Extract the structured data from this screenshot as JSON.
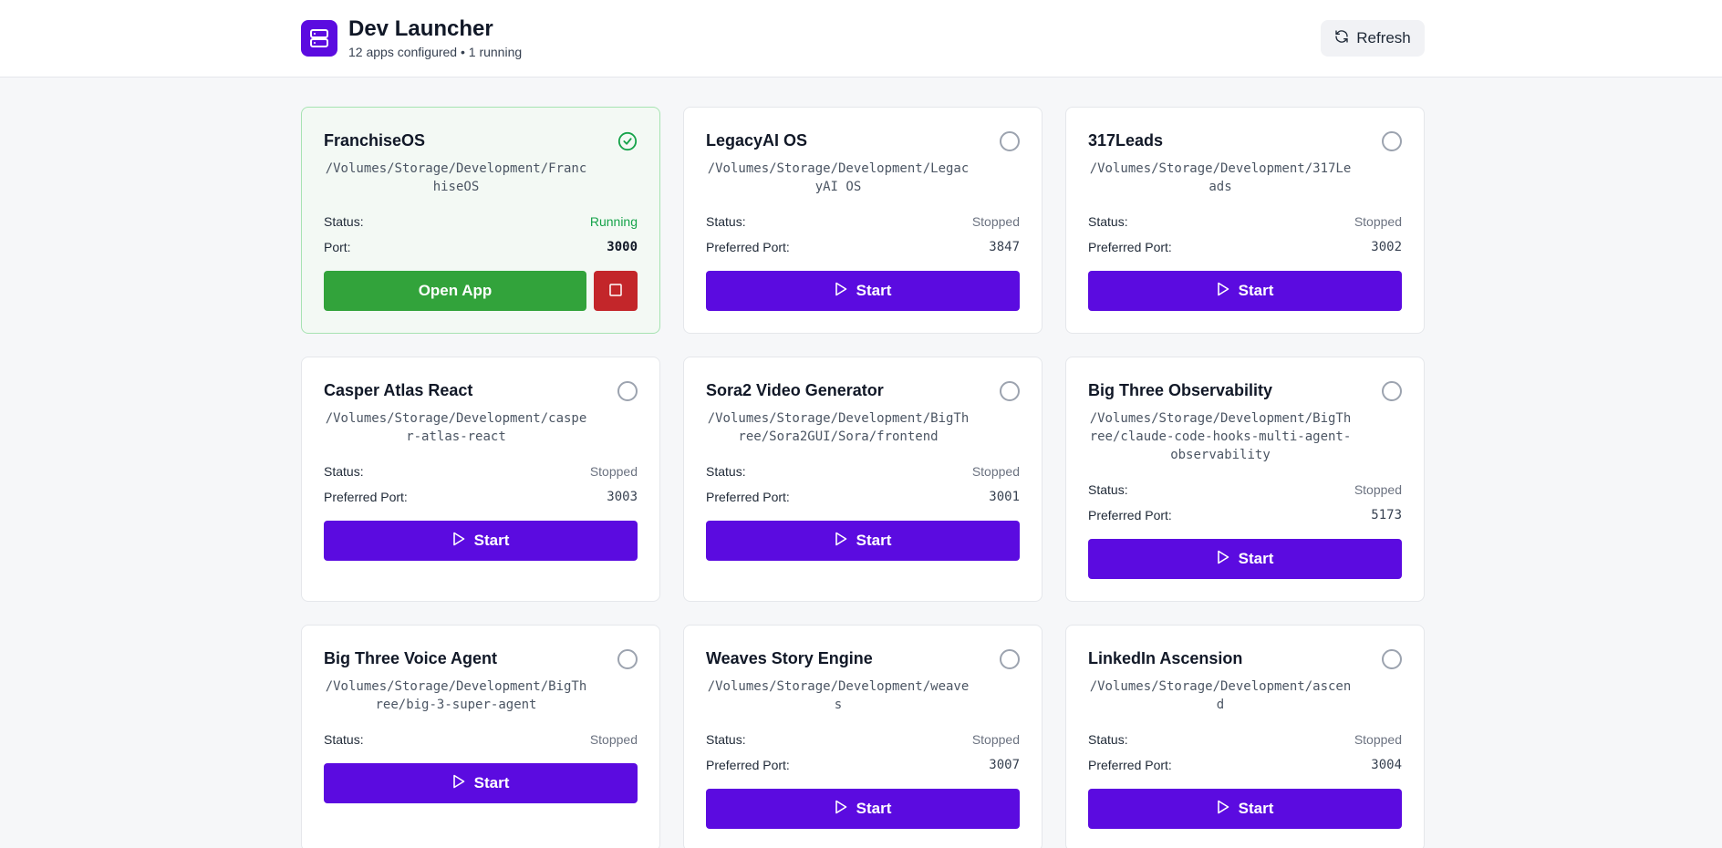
{
  "header": {
    "title": "Dev Launcher",
    "subtitle": "12 apps configured • 1 running",
    "refresh_label": "Refresh"
  },
  "labels": {
    "status": "Status:",
    "port": "Port:",
    "preferred_port": "Preferred Port:",
    "start": "Start",
    "open_app": "Open App"
  },
  "colors": {
    "accent": "#5b0be0",
    "running": "#16a34a",
    "stop": "#c3262a"
  },
  "apps": [
    {
      "name": "FranchiseOS",
      "path": "/Volumes/Storage/Development/FranchiseOS",
      "status": "Running",
      "port": "3000"
    },
    {
      "name": "LegacyAI OS",
      "path": "/Volumes/Storage/Development/LegacyAI OS",
      "status": "Stopped",
      "port": "3847"
    },
    {
      "name": "317Leads",
      "path": "/Volumes/Storage/Development/317Leads",
      "status": "Stopped",
      "port": "3002"
    },
    {
      "name": "Casper Atlas React",
      "path": "/Volumes/Storage/Development/casper-atlas-react",
      "status": "Stopped",
      "port": "3003"
    },
    {
      "name": "Sora2 Video Generator",
      "path": "/Volumes/Storage/Development/BigThree/Sora2GUI/Sora/frontend",
      "status": "Stopped",
      "port": "3001"
    },
    {
      "name": "Big Three Observability",
      "path": "/Volumes/Storage/Development/BigThree/claude-code-hooks-multi-agent-observability",
      "status": "Stopped",
      "port": "5173"
    },
    {
      "name": "Big Three Voice Agent",
      "path": "/Volumes/Storage/Development/BigThree/big-3-super-agent",
      "status": "Stopped",
      "port": ""
    },
    {
      "name": "Weaves Story Engine",
      "path": "/Volumes/Storage/Development/weaves",
      "status": "Stopped",
      "port": "3007"
    },
    {
      "name": "LinkedIn Ascension",
      "path": "/Volumes/Storage/Development/ascend",
      "status": "Stopped",
      "port": "3004"
    }
  ]
}
